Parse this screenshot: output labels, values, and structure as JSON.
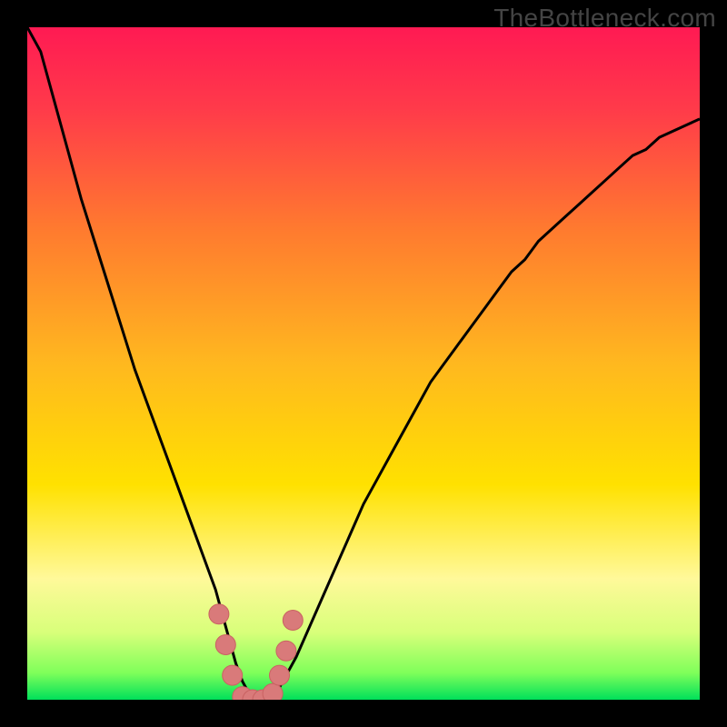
{
  "watermark": "TheBottleneck.com",
  "colors": {
    "frame": "#000000",
    "grad_top": "#ff1a53",
    "grad_mid": "#ffe100",
    "grad_bot": "#00e05a",
    "curve": "#000000",
    "marker_fill": "#d97a7a",
    "marker_stroke": "#c96262"
  },
  "chart_data": {
    "type": "line",
    "title": "",
    "xlabel": "",
    "ylabel": "",
    "xlim": [
      0,
      100
    ],
    "ylim": [
      0,
      110
    ],
    "grid": false,
    "legend": false,
    "series": [
      {
        "name": "bottleneck-curve",
        "x": [
          0,
          2,
          4,
          6,
          8,
          10,
          12,
          14,
          16,
          18,
          20,
          22,
          24,
          26,
          28,
          29,
          30,
          31,
          32,
          33,
          34,
          35,
          36,
          37,
          38,
          40,
          42,
          44,
          46,
          48,
          50,
          52,
          54,
          56,
          58,
          60,
          62,
          64,
          66,
          68,
          70,
          72,
          74,
          76,
          78,
          80,
          82,
          84,
          86,
          88,
          90,
          92,
          94,
          96,
          98,
          100
        ],
        "y": [
          110,
          106,
          98,
          90,
          82,
          75,
          68,
          61,
          54,
          48,
          42,
          36,
          30,
          24,
          18,
          14,
          10,
          6,
          3,
          1,
          0,
          0,
          0,
          1,
          3,
          7,
          12,
          17,
          22,
          27,
          32,
          36,
          40,
          44,
          48,
          52,
          55,
          58,
          61,
          64,
          67,
          70,
          72,
          75,
          77,
          79,
          81,
          83,
          85,
          87,
          89,
          90,
          92,
          93,
          94,
          95
        ]
      }
    ],
    "markers": [
      {
        "x": 28.5,
        "y": 14
      },
      {
        "x": 29.5,
        "y": 9
      },
      {
        "x": 30.5,
        "y": 4
      },
      {
        "x": 32,
        "y": 0.5
      },
      {
        "x": 33.5,
        "y": 0
      },
      {
        "x": 35,
        "y": 0
      },
      {
        "x": 36.5,
        "y": 1
      },
      {
        "x": 37.5,
        "y": 4
      },
      {
        "x": 38.5,
        "y": 8
      },
      {
        "x": 39.5,
        "y": 13
      }
    ]
  }
}
